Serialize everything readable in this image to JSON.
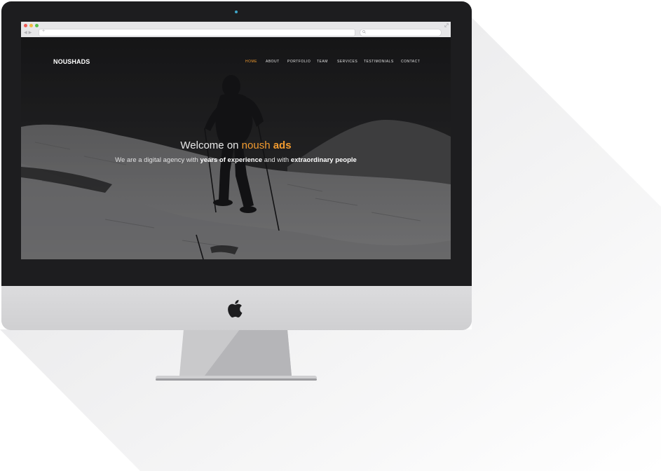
{
  "site": {
    "brand": "NOUSHADS",
    "nav": [
      {
        "label": "HOME",
        "active": true
      },
      {
        "label": "ABOUT",
        "active": false
      },
      {
        "label": "PORTFOLIO",
        "active": false
      },
      {
        "label": "TEAM",
        "active": false
      },
      {
        "label": "SERVICES",
        "active": false
      },
      {
        "label": "TESTIMONIALS",
        "active": false
      },
      {
        "label": "CONTACT",
        "active": false
      }
    ],
    "headline": {
      "prefix": "Welcome on ",
      "accent": "noush",
      "accent_bold": "ads"
    },
    "subline": {
      "part1": "We are a digital agency with ",
      "bold1": "years of experience",
      "part2": " and with ",
      "bold2": "extraordinary people"
    }
  },
  "colors": {
    "accent": "#f29b2f",
    "bezel": "#1d1d1f",
    "chassis": "#d4d4d6",
    "browser_chrome": "#e6e6e8"
  },
  "icons": {
    "traffic_lights": [
      "close-dot",
      "minimize-dot",
      "zoom-dot"
    ],
    "browser": [
      "back-arrow-icon",
      "forward-arrow-icon",
      "add-tab-icon",
      "search-icon",
      "fullscreen-icon"
    ],
    "device": [
      "apple-logo-icon",
      "camera-icon"
    ]
  }
}
